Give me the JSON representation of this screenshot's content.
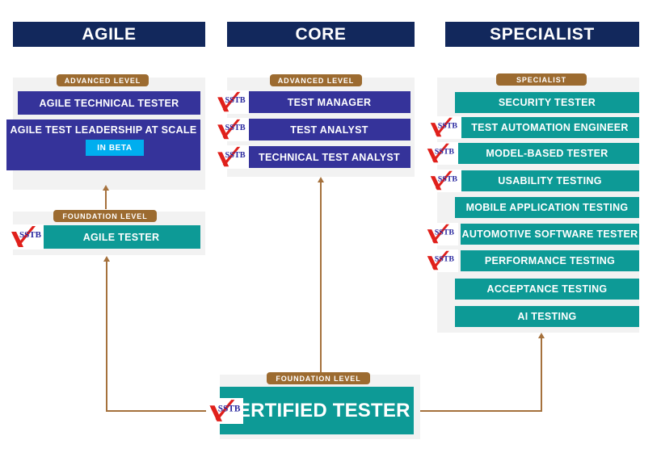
{
  "columns": [
    {
      "key": "agile",
      "title": "AGILE"
    },
    {
      "key": "core",
      "title": "CORE"
    },
    {
      "key": "specialist",
      "title": "SPECIALIST"
    }
  ],
  "badges": {
    "advanced": "ADVANCED  LEVEL",
    "foundation": "FOUNDATION  LEVEL",
    "specialist": "SPECIALIST"
  },
  "agile": {
    "advanced": [
      {
        "label": "AGILE TECHNICAL TESTER",
        "logo": false,
        "beta": null
      },
      {
        "label": "AGILE TEST LEADERSHIP AT SCALE",
        "logo": false,
        "beta": "IN BETA"
      }
    ],
    "foundation": [
      {
        "label": "AGILE TESTER",
        "logo": true
      }
    ]
  },
  "core": {
    "advanced": [
      {
        "label": "TEST MANAGER",
        "logo": true
      },
      {
        "label": "TEST ANALYST",
        "logo": true
      },
      {
        "label": "TECHNICAL TEST ANALYST",
        "logo": true
      }
    ]
  },
  "specialist": {
    "items": [
      {
        "label": "SECURITY TESTER",
        "logo": false
      },
      {
        "label": "TEST AUTOMATION ENGINEER",
        "logo": true
      },
      {
        "label": "MODEL-BASED TESTER",
        "logo": true
      },
      {
        "label": "USABILITY TESTING",
        "logo": true
      },
      {
        "label": "MOBILE APPLICATION TESTING",
        "logo": false
      },
      {
        "label": "AUTOMOTIVE SOFTWARE TESTER",
        "logo": true
      },
      {
        "label": "PERFORMANCE TESTING",
        "logo": true
      },
      {
        "label": "ACCEPTANCE TESTING",
        "logo": false
      },
      {
        "label": "AI TESTING",
        "logo": false
      }
    ]
  },
  "base": {
    "label": "CERTIFIED TESTER",
    "logo": true
  },
  "logo_text": "SSTB",
  "colors": {
    "header_navy": "#12285C",
    "badge_brown": "#9C6B30",
    "advanced_purple": "#35339A",
    "teal": "#0D9A96",
    "beta_cyan": "#00AEEF",
    "connector_brown": "#A5713C",
    "panel_grey": "#f2f2f2",
    "logo_blue": "#2B29A0",
    "logo_red": "#E0201B"
  }
}
